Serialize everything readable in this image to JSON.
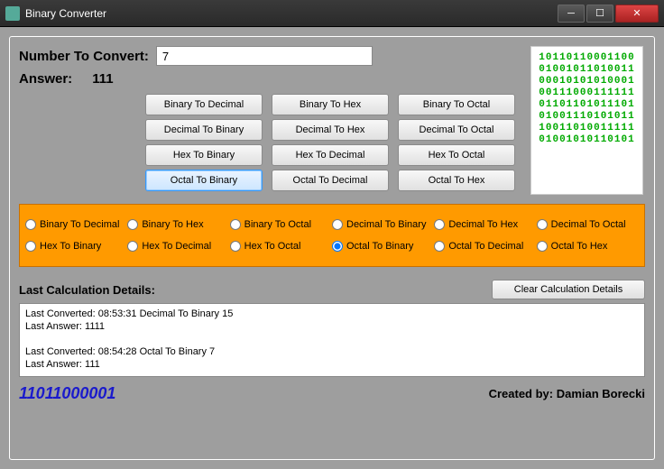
{
  "window": {
    "title": "Binary Converter"
  },
  "input": {
    "label": "Number To Convert:",
    "value": "7"
  },
  "answer": {
    "label": "Answer:",
    "value": "111"
  },
  "buttons": [
    [
      "Binary To Decimal",
      "Binary To Hex",
      "Binary To Octal"
    ],
    [
      "Decimal To Binary",
      "Decimal To Hex",
      "Decimal To Octal"
    ],
    [
      "Hex To Binary",
      "Hex To Decimal",
      "Hex To Octal"
    ],
    [
      "Octal To Binary",
      "Octal To Decimal",
      "Octal To Hex"
    ]
  ],
  "active_button": "Octal To Binary",
  "binary_art": [
    "10110110001100",
    "01001011010011",
    "00010101010001",
    "00111000111111",
    "01101101011101",
    "01001110101011",
    "10011010011111",
    "01001010110101"
  ],
  "radios": [
    "Binary To Decimal",
    "Binary To Hex",
    "Binary To Octal",
    "Decimal To Binary",
    "Decimal To Hex",
    "Decimal To Octal",
    "Hex To Binary",
    "Hex To Decimal",
    "Hex To Octal",
    "Octal To Binary",
    "Octal To Decimal",
    "Octal To Hex"
  ],
  "selected_radio": "Octal To Binary",
  "details": {
    "header": "Last Calculation Details:",
    "clear": "Clear Calculation Details",
    "log": "Last Converted: 08:53:31  Decimal To Binary 15\nLast Answer: 1111\n\nLast Converted: 08:54:28  Octal To Binary 7\nLast Answer: 111"
  },
  "footer": {
    "binary": "11011000001",
    "credit": "Created by: Damian Borecki"
  }
}
